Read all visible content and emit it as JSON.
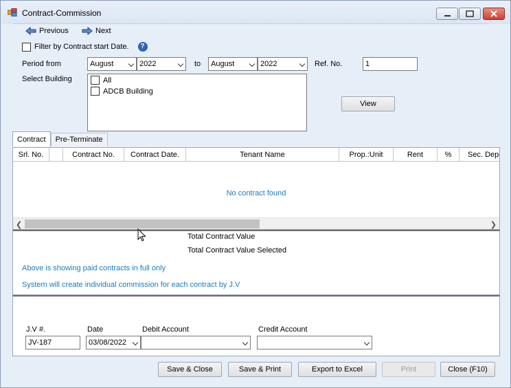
{
  "window": {
    "title": "Contract-Commission"
  },
  "nav": {
    "previous_label": "Previous",
    "next_label": "Next"
  },
  "filter": {
    "label": "Filter by Contract start Date.",
    "checked": false
  },
  "period": {
    "label": "Period from",
    "from_month": "August",
    "from_year": "2022",
    "to_label": "to",
    "to_month": "August",
    "to_year": "2022"
  },
  "ref": {
    "label": "Ref. No.",
    "value": "1"
  },
  "building": {
    "label": "Select Building",
    "items": [
      {
        "label": "All",
        "checked": false
      },
      {
        "label": "ADCB Building",
        "checked": false
      }
    ]
  },
  "view_button": "View",
  "tabs": [
    {
      "label": "Contract",
      "active": true
    },
    {
      "label": "Pre-Terminate",
      "active": false
    }
  ],
  "grid": {
    "columns": [
      "Srl. No.",
      "",
      "Contract No.",
      "Contract Date.",
      "Tenant Name",
      "Prop.:Unit",
      "Rent",
      "%",
      "Sec. Depo"
    ],
    "empty_message": "No contract found"
  },
  "summary": {
    "total_contract_value": "Total Contract Value",
    "total_contract_value_selected": "Total Contract Value Selected",
    "note1": "Above is showing paid contracts in full only",
    "note2": "System will create individual commission for each contract  by J.V"
  },
  "jv": {
    "jv_label": "J.V #.",
    "jv_value": "JV-187",
    "date_label": "Date",
    "date_value": "03/08/2022",
    "debit_label": "Debit Account",
    "debit_value": "",
    "credit_label": "Credit Account",
    "credit_value": ""
  },
  "buttons": {
    "save_close": "Save & Close",
    "save_print": "Save & Print",
    "export_excel": "Export to Excel",
    "print": "Print",
    "close": "Close (F10)"
  },
  "colors": {
    "info_text": "#1a7bbd",
    "help_icon": "#2f63b6"
  }
}
